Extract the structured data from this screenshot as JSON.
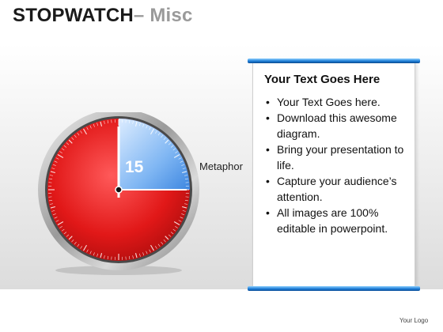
{
  "header": {
    "title_main": "STOPWATCH",
    "title_sub": "– Misc"
  },
  "stopwatch": {
    "seconds_label": "15",
    "label": "Metaphor",
    "elapsed_fraction": 0.25,
    "colors": {
      "elapsed": "#5aa6f0",
      "remaining": "#e51b1b",
      "rim": "#b8b8b8"
    }
  },
  "panel": {
    "heading": "Your Text Goes Here",
    "bullets": [
      "Your Text Goes here.",
      "Download this awesome diagram.",
      "Bring your presentation to life.",
      "Capture your audience’s attention.",
      "All images are 100% editable in powerpoint."
    ],
    "accent_color": "#1f7fd8"
  },
  "footer": {
    "logo_text": "Your Logo"
  }
}
